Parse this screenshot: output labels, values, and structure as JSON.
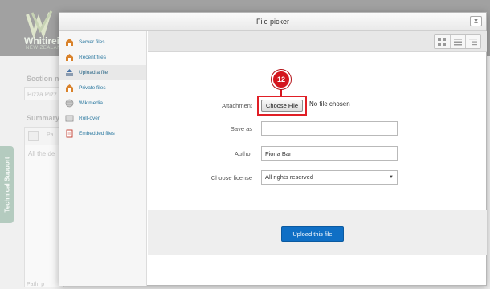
{
  "background": {
    "brand": "Whitirei",
    "brand_sub": "NEW ZEALAND",
    "section_label": "Section n",
    "section_value": "Pizza Pizz",
    "summary_label": "Summary",
    "editor_tool": "Pa",
    "editor_text": "All the de",
    "path_label": "Path: p",
    "tech_support": "Technical Support"
  },
  "dialog": {
    "title": "File picker",
    "close_label": "x",
    "sidebar": [
      {
        "label": "Server files",
        "icon": "server-files-icon"
      },
      {
        "label": "Recent files",
        "icon": "recent-files-icon"
      },
      {
        "label": "Upload a file",
        "icon": "upload-icon",
        "active": true
      },
      {
        "label": "Private files",
        "icon": "private-files-icon"
      },
      {
        "label": "Wikimedia",
        "icon": "wikimedia-icon"
      },
      {
        "label": "Roll-over",
        "icon": "rollover-icon"
      },
      {
        "label": "Embedded files",
        "icon": "embedded-files-icon"
      }
    ],
    "form": {
      "attachment_label": "Attachment",
      "choose_file_label": "Choose File",
      "file_status": "No file chosen",
      "save_as_label": "Save as",
      "save_as_value": "",
      "author_label": "Author",
      "author_value": "Fiona Barr",
      "license_label": "Choose license",
      "license_value": "All rights reserved"
    },
    "upload_button": "Upload this file",
    "step_badge": "12"
  },
  "colors": {
    "header_bg": "#5d5d5d",
    "link": "#2e7aa1",
    "highlight": "#e01f26",
    "badge": "#d4161e",
    "primary_button": "#0f6fc5",
    "tech_tab": "#7fa591"
  }
}
